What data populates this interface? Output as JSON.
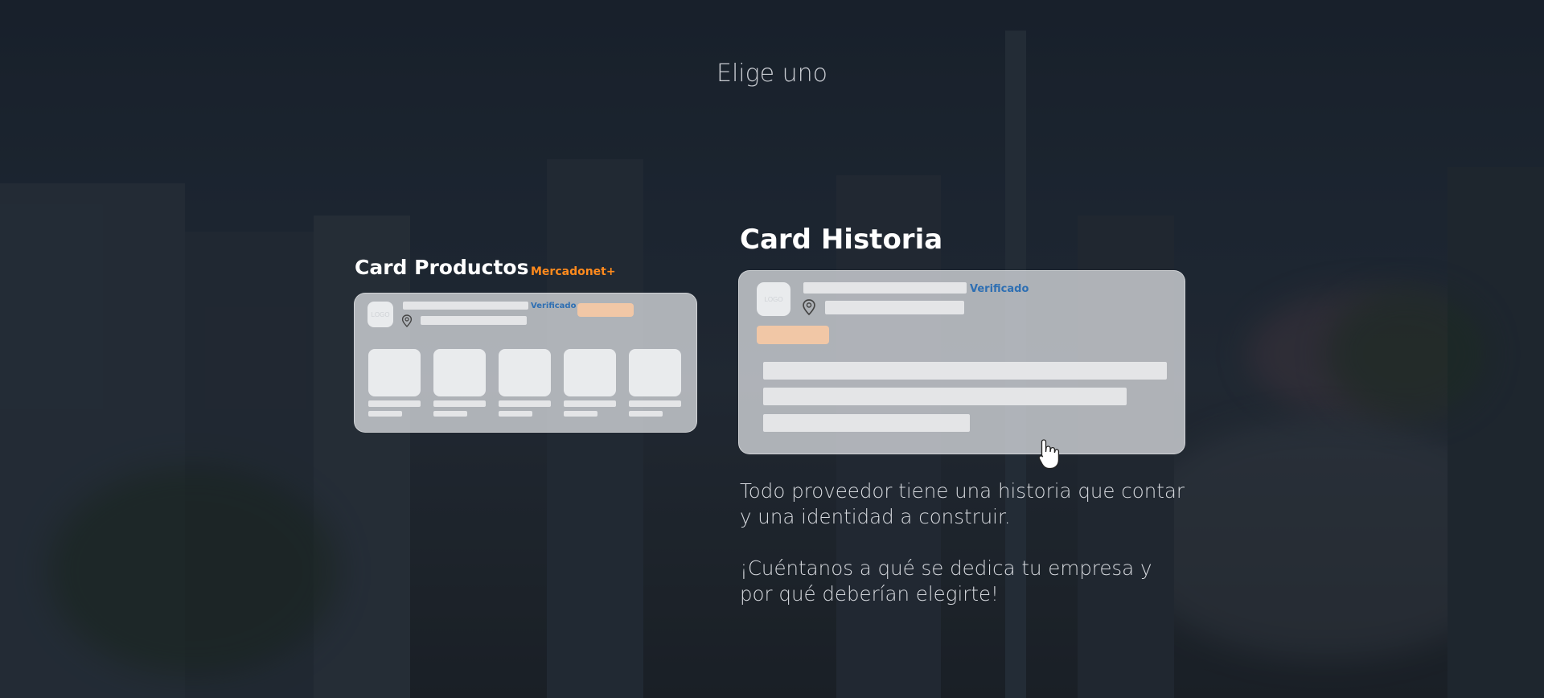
{
  "page": {
    "title": "Elige uno"
  },
  "card_productos": {
    "heading": "Card Productos",
    "badge": "Mercadonet+",
    "logo_text": "LOGO",
    "verified_label": "Verificado"
  },
  "card_historia": {
    "heading": "Card Historia",
    "logo_text": "LOGO",
    "verified_label": "Verificado",
    "description_1": "Todo proveedor tiene una historia que contar y una identidad a construir.",
    "description_2": "¡Cuéntanos a qué se dedica tu empresa y por qué deberían elegirte!"
  },
  "colors": {
    "accent_orange": "#ff8a1d",
    "verified_blue": "#2e6fb3",
    "button_placeholder": "#f1c7a6"
  }
}
